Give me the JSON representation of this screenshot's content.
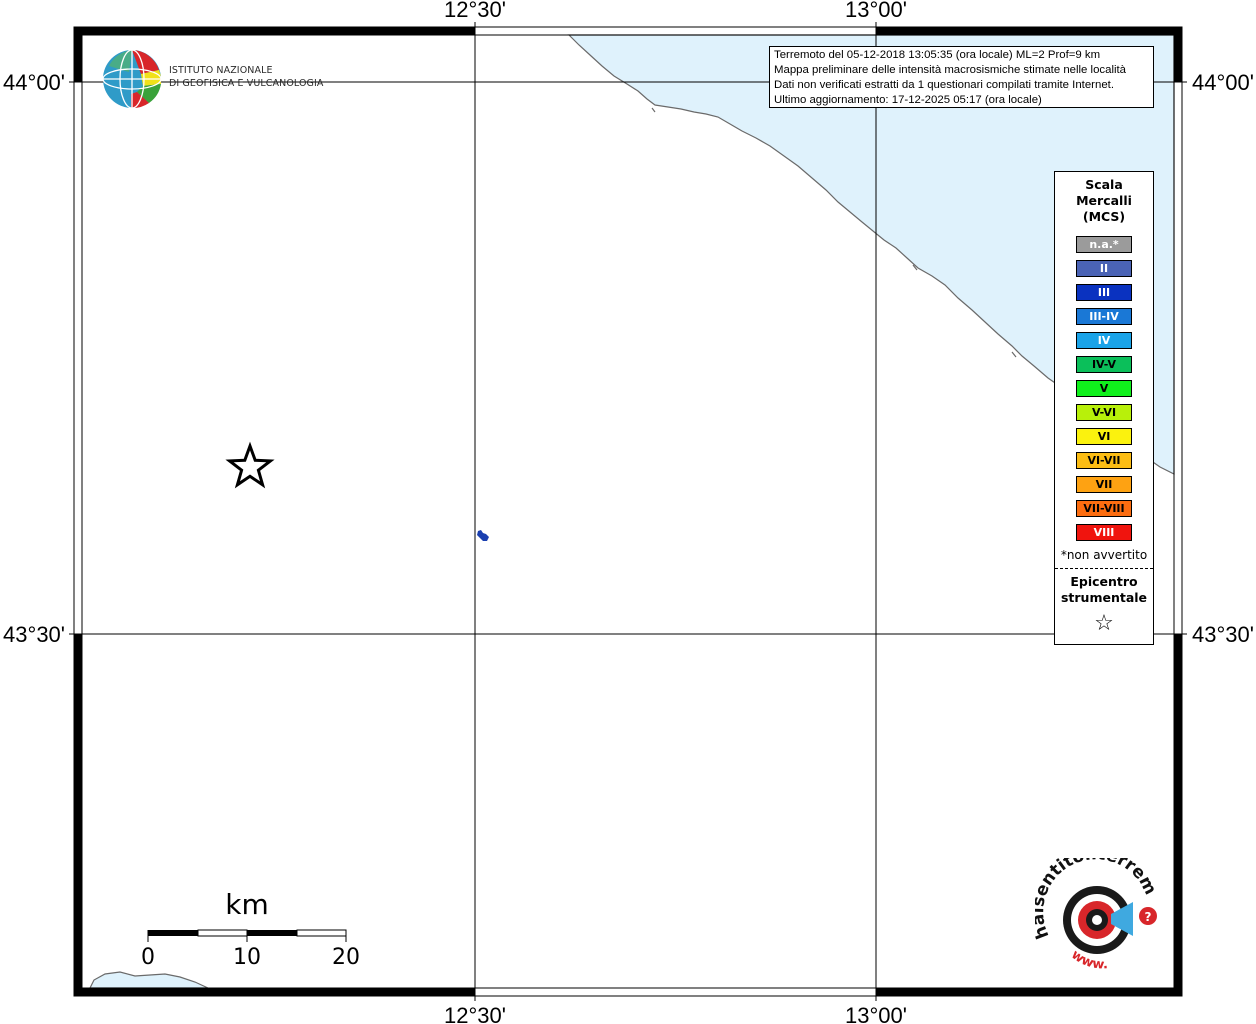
{
  "map": {
    "lon_labels": [
      "12°30'",
      "13°00'"
    ],
    "lat_labels": [
      "44°00'",
      "43°30'"
    ],
    "colors": {
      "sea": "#dff2fc",
      "frame": "#000000",
      "grid": "#000000"
    }
  },
  "info": {
    "line1": "Terremoto del 05-12-2018 13:05:35 (ora locale) ML=2 Prof=9 km",
    "line2": "Mappa preliminare delle intensità macrosismiche stimate nelle località",
    "line3": "Dati non verificati estratti da 1 questionari compilati tramite Internet.",
    "line4": "Ultimo aggiornamento: 17-12-2025 05:17 (ora locale)"
  },
  "legend": {
    "title1": "Scala",
    "title2": "Mercalli",
    "title3": "(MCS)",
    "items": [
      {
        "label": "n.a.*",
        "color": "#9b9b9b",
        "text": "#ffffff"
      },
      {
        "label": "II",
        "color": "#4a63b5",
        "text": "#ffffff"
      },
      {
        "label": "III",
        "color": "#0a32c0",
        "text": "#ffffff"
      },
      {
        "label": "III-IV",
        "color": "#1a78d6",
        "text": "#ffffff"
      },
      {
        "label": "IV",
        "color": "#1aa3e8",
        "text": "#ffffff"
      },
      {
        "label": "IV-V",
        "color": "#0bbf5a",
        "text": "#000000"
      },
      {
        "label": "V",
        "color": "#10f01c",
        "text": "#000000"
      },
      {
        "label": "V-VI",
        "color": "#b8f00a",
        "text": "#000000"
      },
      {
        "label": "VI",
        "color": "#fbf20e",
        "text": "#000000"
      },
      {
        "label": "VI-VII",
        "color": "#fcbd14",
        "text": "#000000"
      },
      {
        "label": "VII",
        "color": "#fea212",
        "text": "#000000"
      },
      {
        "label": "VII-VIII",
        "color": "#fc6d10",
        "text": "#000000"
      },
      {
        "label": "VIII",
        "color": "#f0140e",
        "text": "#ffffff"
      }
    ],
    "note": "*non avvertito",
    "epicenter1": "Epicentro",
    "epicenter2": "strumentale",
    "epicenter_symbol": "☆"
  },
  "scale_bar": {
    "unit": "km",
    "ticks": [
      "0",
      "10",
      "20"
    ]
  },
  "logos": {
    "ingv_line1": "ISTITUTO NAZIONALE",
    "ingv_line2": "DI GEOFISICA E VULCANOLOGIA",
    "hst_text": "haisentitoilterremoto.it",
    "hst_www": "www.",
    "hst_q": "?"
  },
  "markers": {
    "epicenter": "star-icon",
    "report": "intensity-report-icon"
  }
}
